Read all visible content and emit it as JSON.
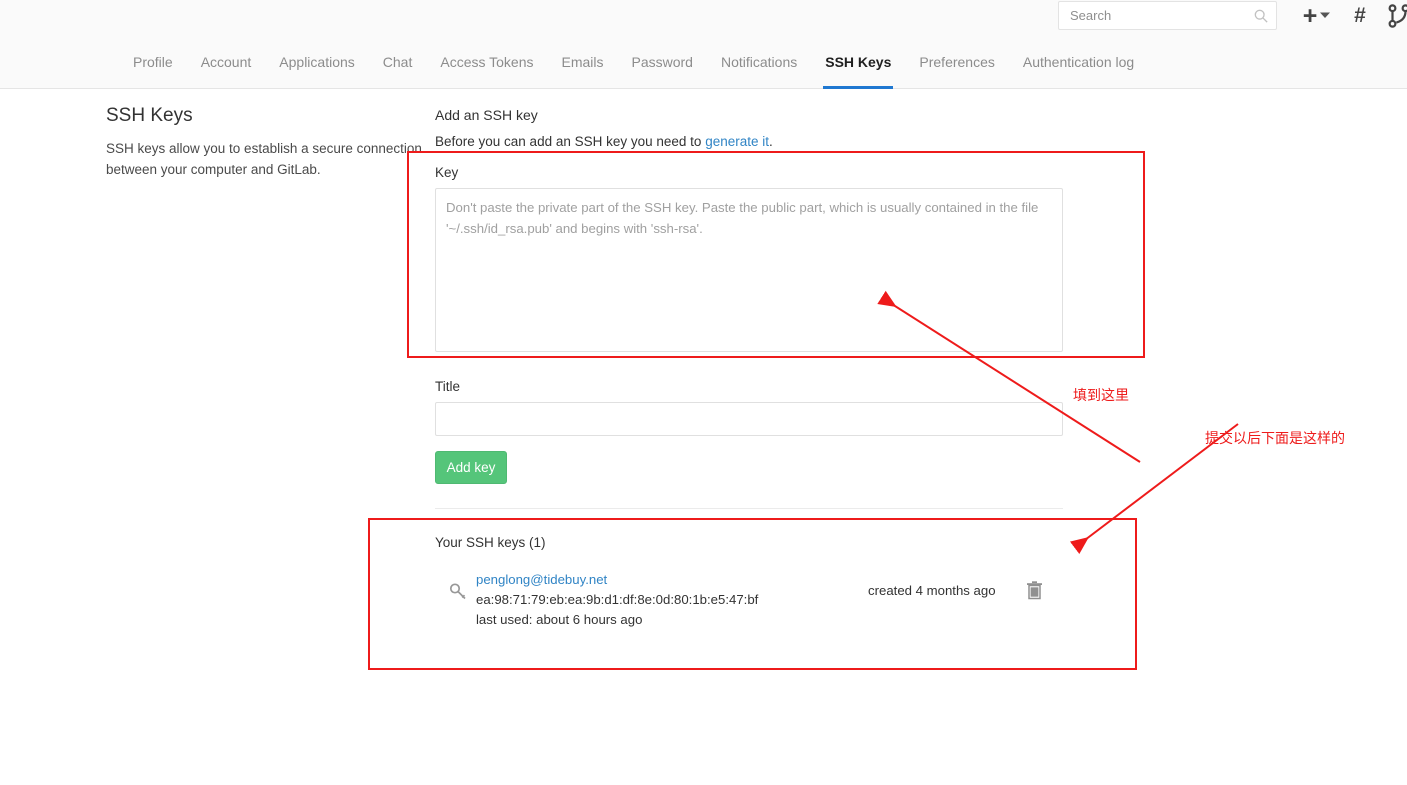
{
  "topbar": {
    "search": {
      "placeholder": "Search",
      "value": ""
    },
    "icons": [
      {
        "name": "plus-icon",
        "glyph": "+"
      },
      {
        "name": "chevron-down-icon",
        "glyph": "▾"
      },
      {
        "name": "hash-icon",
        "glyph": "#"
      },
      {
        "name": "merge-request-icon",
        "glyph": ""
      }
    ]
  },
  "nav": {
    "tabs": [
      {
        "label": "Profile",
        "active": false
      },
      {
        "label": "Account",
        "active": false
      },
      {
        "label": "Applications",
        "active": false
      },
      {
        "label": "Chat",
        "active": false
      },
      {
        "label": "Access Tokens",
        "active": false
      },
      {
        "label": "Emails",
        "active": false
      },
      {
        "label": "Password",
        "active": false
      },
      {
        "label": "Notifications",
        "active": false
      },
      {
        "label": "SSH Keys",
        "active": true
      },
      {
        "label": "Preferences",
        "active": false
      },
      {
        "label": "Authentication log",
        "active": false
      }
    ],
    "active_color": "#1f78d1"
  },
  "sidebar": {
    "title": "SSH Keys",
    "description": "SSH keys allow you to establish a secure connection between your computer and GitLab."
  },
  "main": {
    "title": "Add an SSH key",
    "subtitle_prefix": "Before you can add an SSH key you need to ",
    "subtitle_link": "generate it",
    "subtitle_suffix": ".",
    "key_label": "Key",
    "key_placeholder": "Don't paste the private part of the SSH key. Paste the public part, which is usually contained in the file '~/.ssh/id_rsa.pub' and begins with 'ssh-rsa'.",
    "key_value": "",
    "title_label": "Title",
    "title_placeholder": "",
    "title_value": "",
    "add_key_label": "Add key",
    "add_key_color": "#55c57a"
  },
  "keys_section": {
    "heading": "Your SSH keys (1)",
    "count": 1,
    "rows": [
      {
        "icon": "key-glyph-icon",
        "email": "penglong@tidebuy.net",
        "fingerprint": "ea:98:71:79:eb:ea:9b:d1:df:8e:0d:80:1b:e5:47:bf",
        "last_used": "last used: about 6 hours ago",
        "created": "created 4 months ago",
        "delete_icon": "trash-icon"
      }
    ]
  },
  "annotations": {
    "color": "#ee1b1b",
    "fill_here": "填到这里",
    "after_submit": "提交以后下面是这样的"
  }
}
